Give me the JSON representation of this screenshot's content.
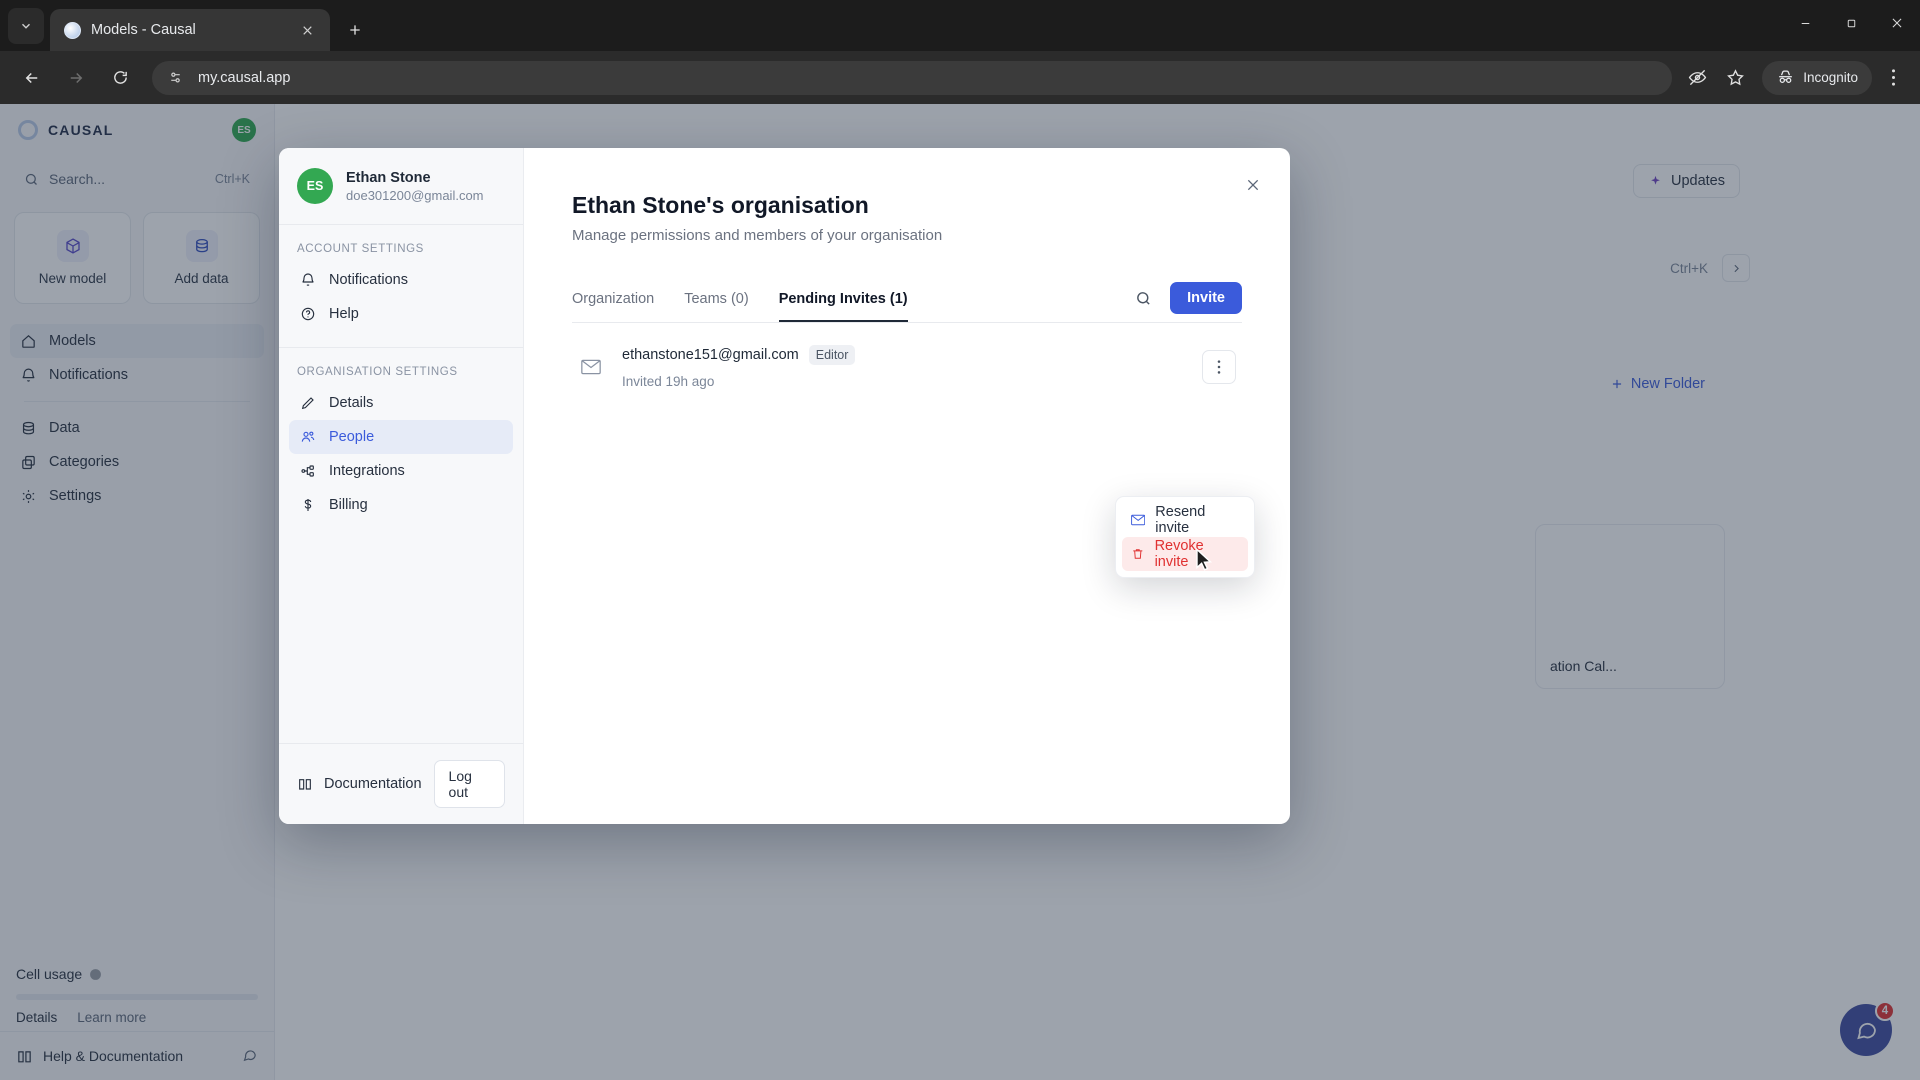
{
  "browser": {
    "tab": {
      "title": "Models - Causal",
      "favicon": "causal-favicon"
    },
    "new_tab_label": "+",
    "url": "my.causal.app",
    "profile_label": "Incognito",
    "window_controls": {
      "minimize": "—",
      "maximize": "❐",
      "close": "✕"
    }
  },
  "app": {
    "brand": "CAUSAL",
    "avatar_initials": "ES",
    "search": {
      "placeholder": "Search...",
      "shortcut": "Ctrl+K"
    },
    "quick_actions": [
      {
        "label": "New model",
        "icon": "cube-icon"
      },
      {
        "label": "Add data",
        "icon": "database-icon"
      }
    ],
    "nav": [
      {
        "label": "Models",
        "icon": "home-icon",
        "active": true
      },
      {
        "label": "Notifications",
        "icon": "bell-icon",
        "active": false
      },
      {
        "label": "Data",
        "icon": "database-icon",
        "active": false
      },
      {
        "label": "Categories",
        "icon": "copy-icon",
        "active": false
      },
      {
        "label": "Settings",
        "icon": "gear-icon",
        "active": false
      }
    ],
    "usage": {
      "title": "Cell usage",
      "details_label": "Details",
      "learn_more_label": "Learn more"
    },
    "help_label": "Help & Documentation",
    "main": {
      "updates_label": "Updates",
      "search_shortcut": "Ctrl+K",
      "new_folder_label": "New Folder",
      "card_label": "ation Cal...",
      "chat_badge": "4"
    }
  },
  "modal": {
    "user": {
      "initials": "ES",
      "name": "Ethan Stone",
      "email": "doe301200@gmail.com"
    },
    "groups": [
      {
        "label": "ACCOUNT SETTINGS",
        "items": [
          {
            "label": "Notifications",
            "icon": "bell-icon",
            "active": false
          },
          {
            "label": "Help",
            "icon": "help-circle-icon",
            "active": false
          }
        ]
      },
      {
        "label": "ORGANISATION SETTINGS",
        "items": [
          {
            "label": "Details",
            "icon": "pencil-icon",
            "active": false
          },
          {
            "label": "People",
            "icon": "people-icon",
            "active": true
          },
          {
            "label": "Integrations",
            "icon": "nodes-icon",
            "active": false
          },
          {
            "label": "Billing",
            "icon": "dollar-icon",
            "active": false
          }
        ]
      }
    ],
    "footer": {
      "documentation_label": "Documentation",
      "logout_label": "Log out"
    },
    "close_label": "✕",
    "title": "Ethan Stone's organisation",
    "subtitle": "Manage permissions and members of your organisation",
    "tabs": [
      {
        "label": "Organization",
        "active": false
      },
      {
        "label": "Teams (0)",
        "active": false
      },
      {
        "label": "Pending Invites (1)",
        "active": true
      }
    ],
    "invite_button_label": "Invite",
    "invites": [
      {
        "email": "ethanstone151@gmail.com",
        "role": "Editor",
        "invited_at": "Invited 19h ago"
      }
    ],
    "context_menu": [
      {
        "label": "Resend invite",
        "icon": "envelope-icon",
        "danger": false,
        "hovered": false
      },
      {
        "label": "Revoke invite",
        "icon": "trash-icon",
        "danger": true,
        "hovered": true
      }
    ]
  },
  "colors": {
    "accent": "#3b5bdb",
    "danger": "#e03131",
    "avatar_green": "#33a852",
    "modal_bg": "#ffffff",
    "sidebar_bg": "#f7f8fa"
  }
}
